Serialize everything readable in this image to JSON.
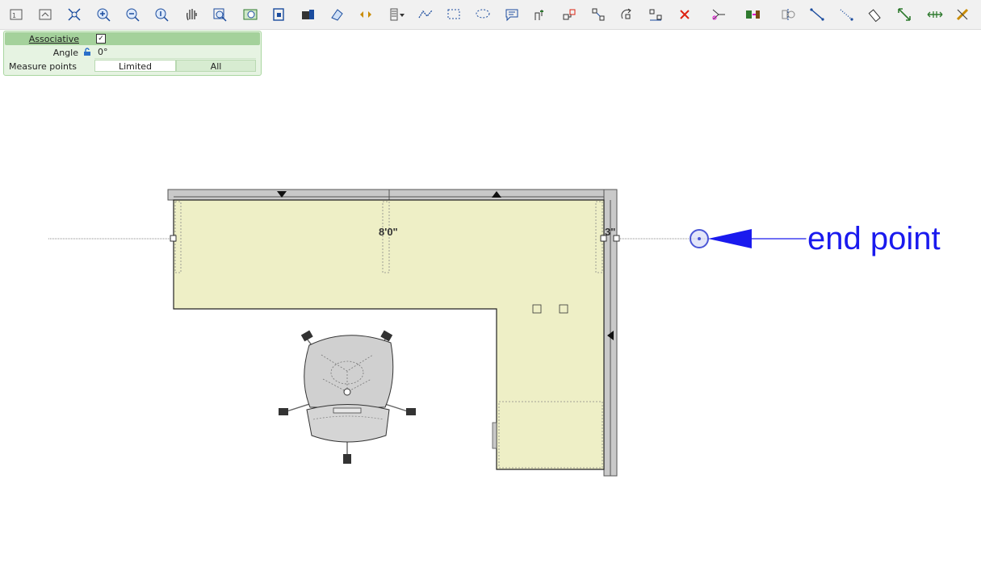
{
  "toolbar": {
    "icons": [
      "zoom-one-to-one-icon",
      "zoom-previous-icon",
      "zoom-extents-icon",
      "zoom-in-icon",
      "zoom-out-icon",
      "zoom-realtime-icon",
      "pan-hand-icon",
      "zoom-window-icon",
      "zoom-selection-icon",
      "select-frame-icon",
      "layers-icon",
      "eraser-icon",
      "move-arrows-icon",
      "list-dropdown-icon",
      "polyline-icon",
      "selection-rectangle-icon",
      "lasso-icon",
      "annotation-icon",
      "stretch-icon",
      "connect-icon",
      "align-icon",
      "rotate-icon",
      "distribute-icon",
      "delete-icon",
      "trim-icon",
      "replace-icon",
      "mirror-icon",
      "line-icon",
      "dotted-line-icon",
      "measure-tape-icon",
      "dimension-icon",
      "chain-dimension-icon",
      "ruler-settings-icon"
    ]
  },
  "properties": {
    "associative_label": "Associative",
    "associative_checked": "✓",
    "angle_label": "Angle",
    "angle_value": "0°",
    "measure_points_label": "Measure points",
    "measure_points_options": [
      "Limited",
      "All"
    ],
    "measure_points_selected": "Limited"
  },
  "drawing": {
    "dimension_main": "8'0\"",
    "dimension_small": "3\"",
    "annotation_text": "end point",
    "annotation_color": "#1a1aee",
    "desk_fill": "#eeefc6",
    "panel_fill": "#c9c9c9",
    "chair_fill": "#d0d0d0"
  }
}
